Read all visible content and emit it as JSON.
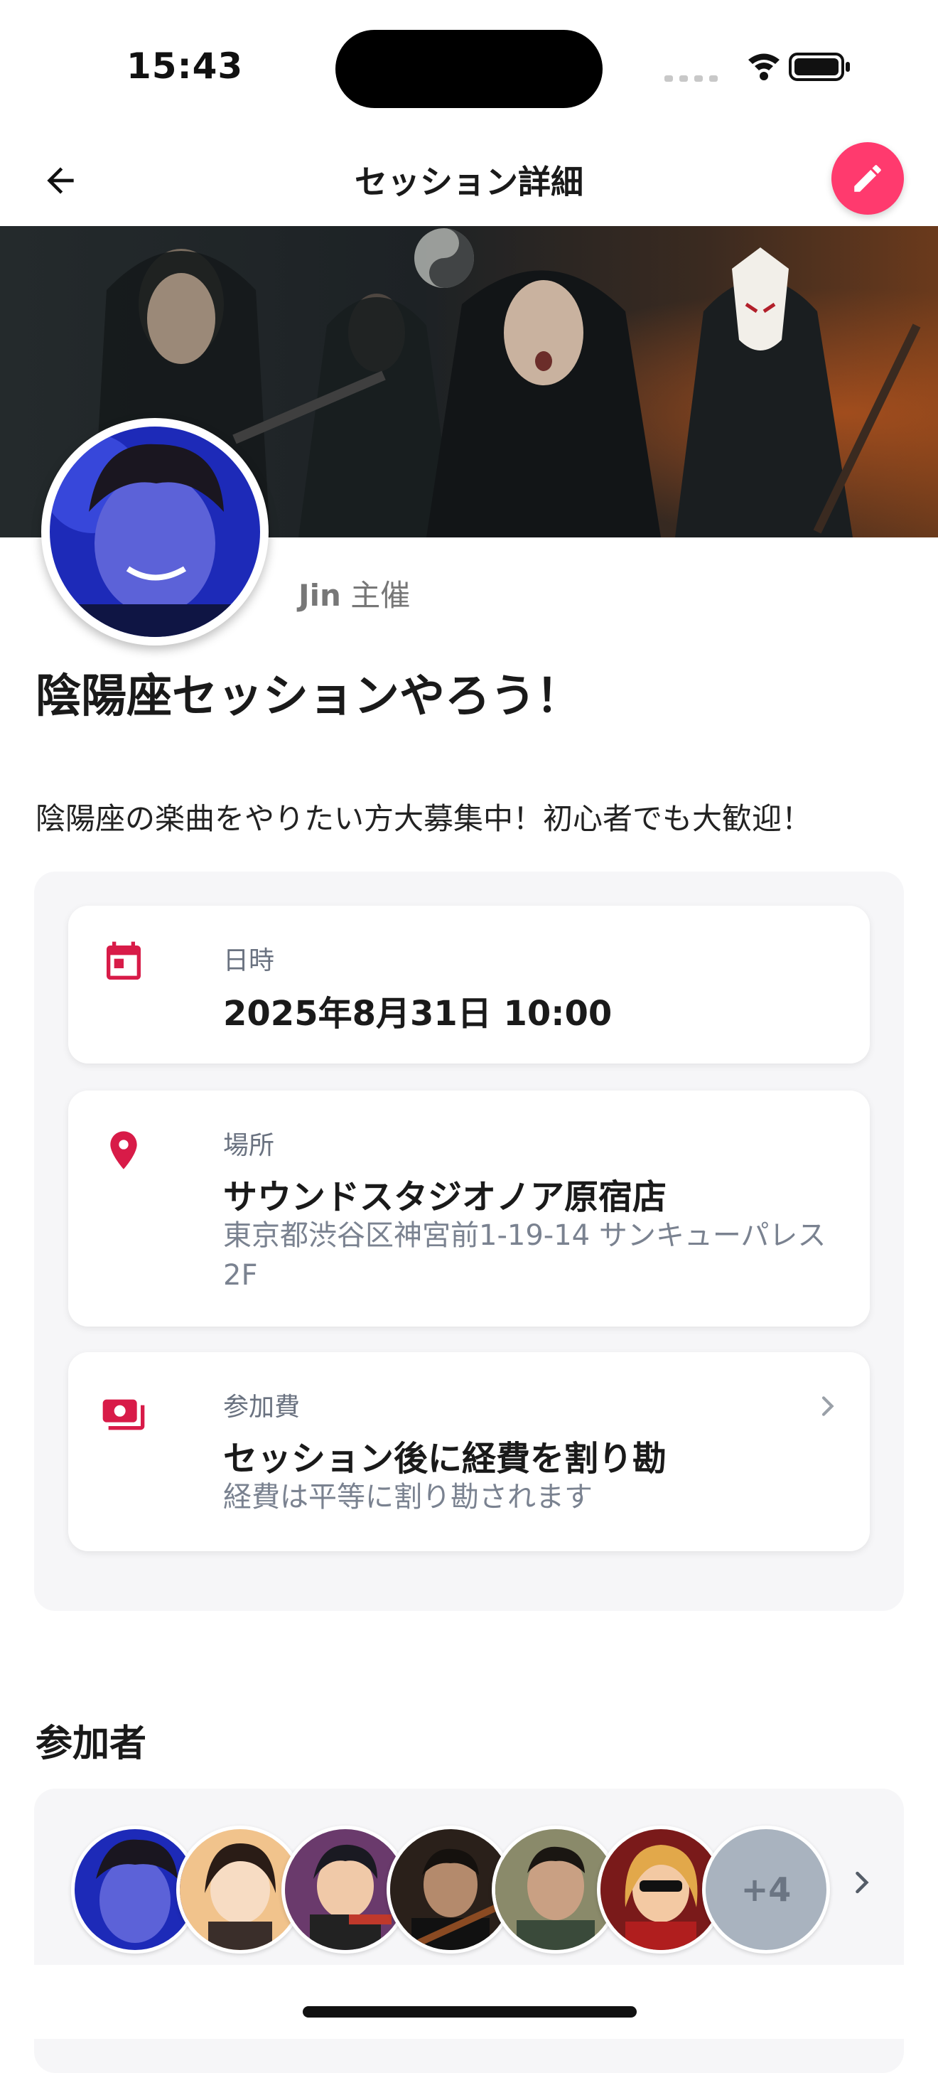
{
  "status_bar": {
    "time": "15:43"
  },
  "nav": {
    "title": "セッション詳細",
    "back_icon": "arrow-left-icon",
    "edit_icon": "pencil-icon",
    "accent": "#ff3a6e"
  },
  "host": {
    "name": "Jin",
    "suffix": "主催"
  },
  "session": {
    "title": "陰陽座セッションやろう！",
    "description": "陰陽座の楽曲をやりたい方大募集中！初心者でも大歓迎！"
  },
  "info": {
    "datetime": {
      "label": "日時",
      "value": "2025年8月31日 10:00",
      "icon": "calendar-icon"
    },
    "location": {
      "label": "場所",
      "value": "サウンドスタジオノア原宿店",
      "address": "東京都渋谷区神宮前1-19-14 サンキューパレス2F",
      "icon": "map-pin-icon"
    },
    "fee": {
      "label": "参加費",
      "value": "セッション後に経費を割り勘",
      "note": "経費は平等に割り勘されます",
      "icon": "money-icon"
    },
    "icon_color": "#d81b48"
  },
  "participants": {
    "title": "参加者",
    "more_count": "+4"
  }
}
